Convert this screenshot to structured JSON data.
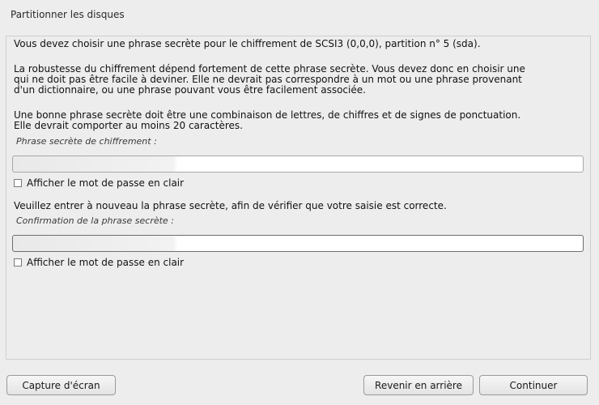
{
  "window": {
    "title": "Partitionner les disques"
  },
  "intro": {
    "line1": "Vous devez choisir une phrase secrète pour le chiffrement de SCSI3 (0,0,0), partition n° 5 (sda)."
  },
  "robustness": {
    "line1": "La robustesse du chiffrement dépend fortement de cette phrase secrète. Vous devez donc en choisir une",
    "line2": "qui ne doit pas être facile à deviner. Elle ne devrait pas correspondre à un mot ou une phrase provenant",
    "line3": "d'un dictionnaire, ou une phrase pouvant vous être facilement associée."
  },
  "good_phrase": {
    "line1": "Une bonne phrase secrète doit être une combinaison de lettres, de chiffres et de signes de ponctuation.",
    "line2": "Elle devrait comporter au moins 20 caractères."
  },
  "passphrase": {
    "label": "Phrase secrète de chiffrement :",
    "value": "",
    "show_label": "Afficher le mot de passe en clair",
    "show_checked": false
  },
  "reenter": {
    "text": "Veuillez entrer à nouveau la phrase secrète, afin de vérifier que votre saisie est correcte."
  },
  "confirmation": {
    "label": "Confirmation de la phrase secrète :",
    "value": "",
    "show_label": "Afficher le mot de passe en clair",
    "show_checked": false
  },
  "buttons": {
    "screenshot": "Capture d'écran",
    "back": "Revenir en arrière",
    "continue": "Continuer"
  }
}
